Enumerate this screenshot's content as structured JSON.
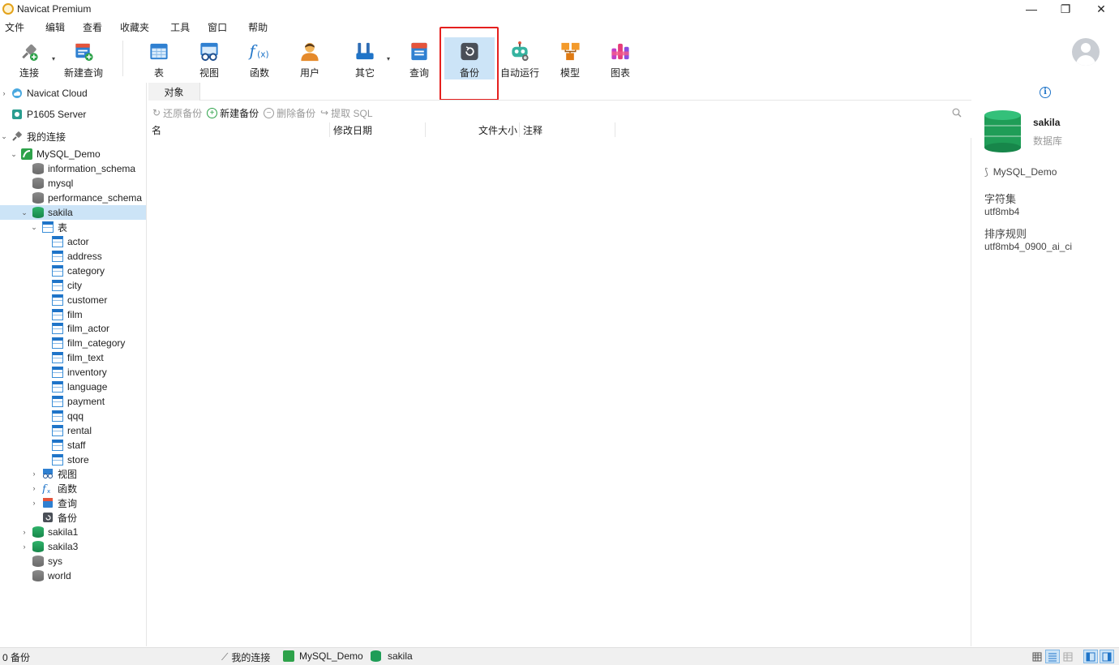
{
  "window": {
    "title": "Navicat Premium",
    "controls": {
      "minimize": "—",
      "maximize": "❐",
      "close": "✕"
    }
  },
  "menu": [
    "文件",
    "编辑",
    "查看",
    "收藏夹",
    "工具",
    "窗口",
    "帮助"
  ],
  "toolbar": {
    "items": [
      {
        "label": "连接",
        "icon": "plug-connect-icon"
      },
      {
        "label": "新建查询",
        "icon": "new-query-icon"
      },
      {
        "label": "表",
        "icon": "table-icon"
      },
      {
        "label": "视图",
        "icon": "view-glasses-icon"
      },
      {
        "label": "函数",
        "icon": "function-fx-icon"
      },
      {
        "label": "用户",
        "icon": "user-icon"
      },
      {
        "label": "其它",
        "icon": "tools-icon"
      },
      {
        "label": "查询",
        "icon": "query-icon"
      },
      {
        "label": "备份",
        "icon": "backup-icon"
      },
      {
        "label": "自动运行",
        "icon": "robot-icon"
      },
      {
        "label": "模型",
        "icon": "model-icon"
      },
      {
        "label": "图表",
        "icon": "chart-icon"
      }
    ],
    "active": "备份",
    "highlight_color": "#e5201e"
  },
  "tree": {
    "navicat_cloud": "Navicat Cloud",
    "server": "P1605 Server",
    "my_connections": "我的连接",
    "connection": "MySQL_Demo",
    "databases_top": [
      "information_schema",
      "mysql",
      "performance_schema"
    ],
    "selected_db": "sakila",
    "tables_folder": "表",
    "tables": [
      "actor",
      "address",
      "category",
      "city",
      "customer",
      "film",
      "film_actor",
      "film_category",
      "film_text",
      "inventory",
      "language",
      "payment",
      "qqq",
      "rental",
      "staff",
      "store"
    ],
    "folders": [
      "视图",
      "函数",
      "查询",
      "备份"
    ],
    "databases_bottom": [
      "sakila1",
      "sakila3",
      "sys",
      "world"
    ]
  },
  "content": {
    "tab": "对象",
    "actions": {
      "restore": "还原备份",
      "new": "新建备份",
      "delete": "删除备份",
      "extract": "提取 SQL"
    },
    "columns": [
      "名",
      "修改日期",
      "文件大小",
      "注释"
    ]
  },
  "info": {
    "name": "sakila",
    "type": "数据库",
    "connection": "MySQL_Demo",
    "charset_label": "字符集",
    "charset": "utf8mb4",
    "collation_label": "排序规则",
    "collation": "utf8mb4_0900_ai_ci"
  },
  "status": {
    "count": "0 备份",
    "crumb_connections": "我的连接",
    "crumb_connection": "MySQL_Demo",
    "crumb_db": "sakila"
  },
  "colors": {
    "selection": "#cce4f7",
    "db_green": "#1f9d57",
    "db_gray": "#767676",
    "accent_blue": "#1f74c8"
  }
}
